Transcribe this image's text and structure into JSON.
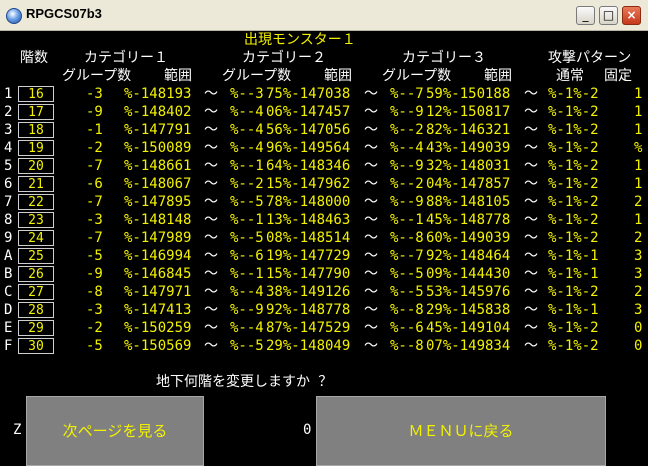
{
  "window": {
    "title": "RPGCS07b3",
    "controls": {
      "minimize": "_",
      "maximize": "□",
      "close": "×"
    }
  },
  "screen": {
    "title": "出現モンスター１",
    "headers": {
      "floor": "階数",
      "cat1": "カテゴリー１",
      "cat2": "カテゴリー２",
      "cat3": "カテゴリー３",
      "attack": "攻撃パターン",
      "group_count": "グループ数",
      "range": "範囲",
      "normal": "通常",
      "fixed": "固定"
    },
    "rows": [
      {
        "key": "1",
        "floor": "16",
        "g1": "-3",
        "r1": "%-148193",
        "s2": "%--3",
        "r2": "75%-147038",
        "s3": "%--7",
        "r3": "59%-150188",
        "atk": "%-1%-2",
        "fx": "1"
      },
      {
        "key": "2",
        "floor": "17",
        "g1": "-9",
        "r1": "%-148402",
        "s2": "%--4",
        "r2": "06%-147457",
        "s3": "%--9",
        "r3": "12%-150817",
        "atk": "%-1%-2",
        "fx": "1"
      },
      {
        "key": "3",
        "floor": "18",
        "g1": "-1",
        "r1": "%-147791",
        "s2": "%--4",
        "r2": "56%-147056",
        "s3": "%--2",
        "r3": "82%-146321",
        "atk": "%-1%-2",
        "fx": "1"
      },
      {
        "key": "4",
        "floor": "19",
        "g1": "-2",
        "r1": "%-150089",
        "s2": "%--4",
        "r2": "96%-149564",
        "s3": "%--4",
        "r3": "43%-149039",
        "atk": "%-1%-2",
        "fx": "%"
      },
      {
        "key": "5",
        "floor": "20",
        "g1": "-7",
        "r1": "%-148661",
        "s2": "%--1",
        "r2": "64%-148346",
        "s3": "%--9",
        "r3": "32%-148031",
        "atk": "%-1%-2",
        "fx": "1"
      },
      {
        "key": "6",
        "floor": "21",
        "g1": "-6",
        "r1": "%-148067",
        "s2": "%--2",
        "r2": "15%-147962",
        "s3": "%--2",
        "r3": "04%-147857",
        "atk": "%-1%-2",
        "fx": "1"
      },
      {
        "key": "7",
        "floor": "22",
        "g1": "-7",
        "r1": "%-147895",
        "s2": "%--5",
        "r2": "78%-148000",
        "s3": "%--9",
        "r3": "88%-148105",
        "atk": "%-1%-2",
        "fx": "2"
      },
      {
        "key": "8",
        "floor": "23",
        "g1": "-3",
        "r1": "%-148148",
        "s2": "%--1",
        "r2": "13%-148463",
        "s3": "%--1",
        "r3": "45%-148778",
        "atk": "%-1%-2",
        "fx": "1"
      },
      {
        "key": "9",
        "floor": "24",
        "g1": "-7",
        "r1": "%-147989",
        "s2": "%--5",
        "r2": "08%-148514",
        "s3": "%--8",
        "r3": "60%-149039",
        "atk": "%-1%-2",
        "fx": "2"
      },
      {
        "key": "A",
        "floor": "25",
        "g1": "-5",
        "r1": "%-146994",
        "s2": "%--6",
        "r2": "19%-147729",
        "s3": "%--7",
        "r3": "92%-148464",
        "atk": "%-1%-1",
        "fx": "3"
      },
      {
        "key": "B",
        "floor": "26",
        "g1": "-9",
        "r1": "%-146845",
        "s2": "%--1",
        "r2": "15%-147790",
        "s3": "%--5",
        "r3": "09%-144430",
        "atk": "%-1%-1",
        "fx": "3"
      },
      {
        "key": "C",
        "floor": "27",
        "g1": "-8",
        "r1": "%-147971",
        "s2": "%--4",
        "r2": "38%-149126",
        "s3": "%--5",
        "r3": "53%-145976",
        "atk": "%-1%-2",
        "fx": "2"
      },
      {
        "key": "D",
        "floor": "28",
        "g1": "-3",
        "r1": "%-147413",
        "s2": "%--9",
        "r2": "92%-148778",
        "s3": "%--8",
        "r3": "29%-145838",
        "atk": "%-1%-1",
        "fx": "3"
      },
      {
        "key": "E",
        "floor": "29",
        "g1": "-2",
        "r1": "%-150259",
        "s2": "%--4",
        "r2": "87%-147529",
        "s3": "%--6",
        "r3": "45%-149104",
        "atk": "%-1%-2",
        "fx": "0"
      },
      {
        "key": "F",
        "floor": "30",
        "g1": "-5",
        "r1": "%-150569",
        "s2": "%--5",
        "r2": "29%-148049",
        "s3": "%--8",
        "r3": "07%-149834",
        "atk": "%-1%-2",
        "fx": "0"
      }
    ],
    "tilde": "～",
    "prompt": "地下何階を変更しますか ？",
    "footer": {
      "key_z": "Z",
      "next_page": "次ページを見る",
      "key_0": "0",
      "back_menu": "ＭＥＮＵに戻る"
    }
  }
}
